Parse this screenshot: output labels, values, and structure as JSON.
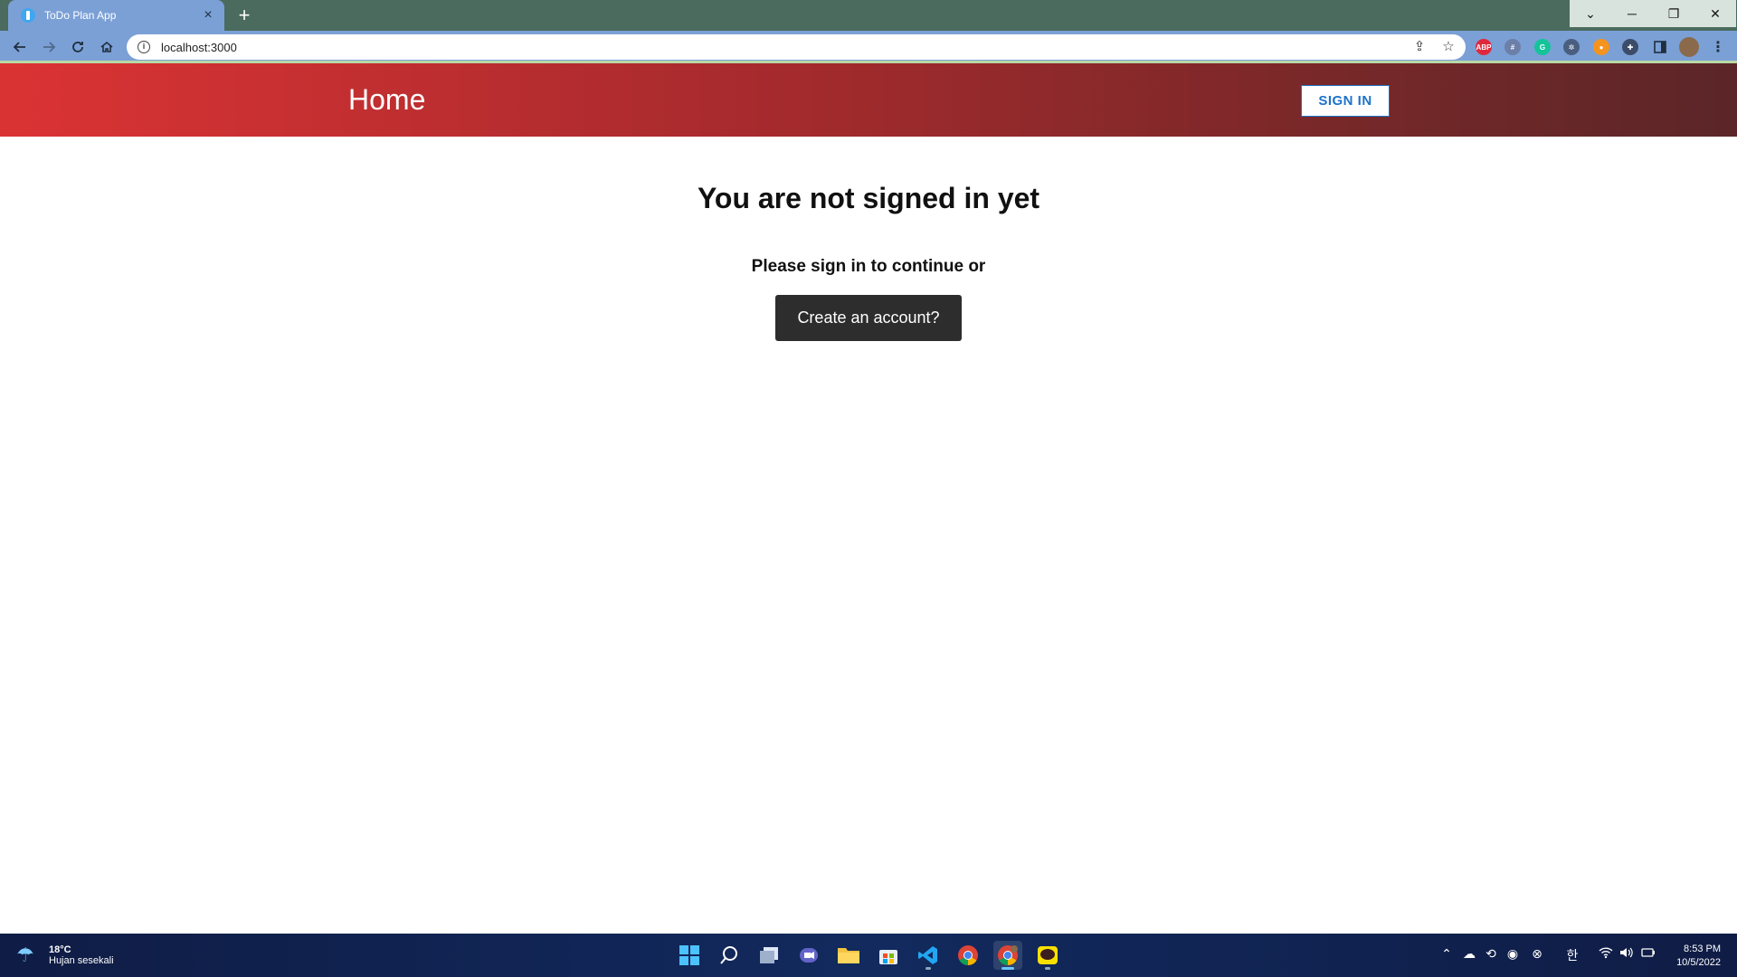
{
  "browser": {
    "tab_title": "ToDo Plan App",
    "tab_close": "×",
    "new_tab": "+",
    "url": "localhost:3000",
    "window_controls": {
      "dropdown": "⌄",
      "minimize": "─",
      "restore": "❐",
      "close": "✕"
    }
  },
  "extensions": [
    {
      "name": "adblock-icon",
      "label": "ABP",
      "color": "#e0283c"
    },
    {
      "name": "grid-extension-icon",
      "label": "#",
      "color": "#6b7fa8"
    },
    {
      "name": "grammarly-icon",
      "label": "G",
      "color": "#15c39a"
    },
    {
      "name": "bug-extension-icon",
      "label": "✲",
      "color": "#4a5f80"
    },
    {
      "name": "orange-extension-icon",
      "label": "●",
      "color": "#f4931e"
    },
    {
      "name": "puzzle-icon",
      "label": "✚",
      "color": "#3c4d6a"
    }
  ],
  "appbar": {
    "title": "Home",
    "sign_in_label": "SIGN IN",
    "gradient_start": "#db3334",
    "gradient_end": "#5b2628"
  },
  "main": {
    "heading": "You are not signed in yet",
    "subtext": "Please sign in to continue or",
    "create_account_label": "Create an account?"
  },
  "taskbar": {
    "weather_temp": "18°C",
    "weather_condition": "Hujan sesekali",
    "ime": "한",
    "time": "8:53 PM",
    "date": "10/5/2022"
  }
}
